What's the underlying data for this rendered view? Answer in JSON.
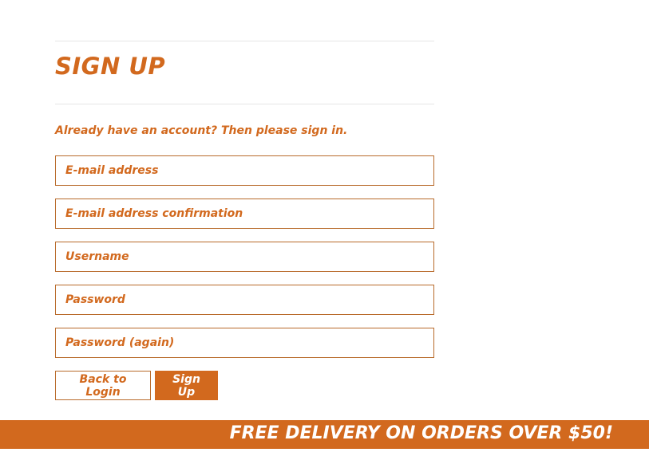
{
  "form": {
    "title": "SIGN UP",
    "subtitle": "Already have an account? Then please sign in.",
    "fields": [
      {
        "placeholder": "E-mail address",
        "value": ""
      },
      {
        "placeholder": "E-mail address confirmation",
        "value": ""
      },
      {
        "placeholder": "Username",
        "value": ""
      },
      {
        "placeholder": "Password",
        "value": ""
      },
      {
        "placeholder": "Password (again)",
        "value": ""
      }
    ],
    "back_label": "Back to Login",
    "signup_label": "Sign Up"
  },
  "banner": {
    "text": "FREE DELIVERY ON ORDERS OVER $50!"
  },
  "colors": {
    "accent": "#d2691e",
    "border": "#b86a2a",
    "divider": "#e6e6e6",
    "background": "#ffffff"
  }
}
